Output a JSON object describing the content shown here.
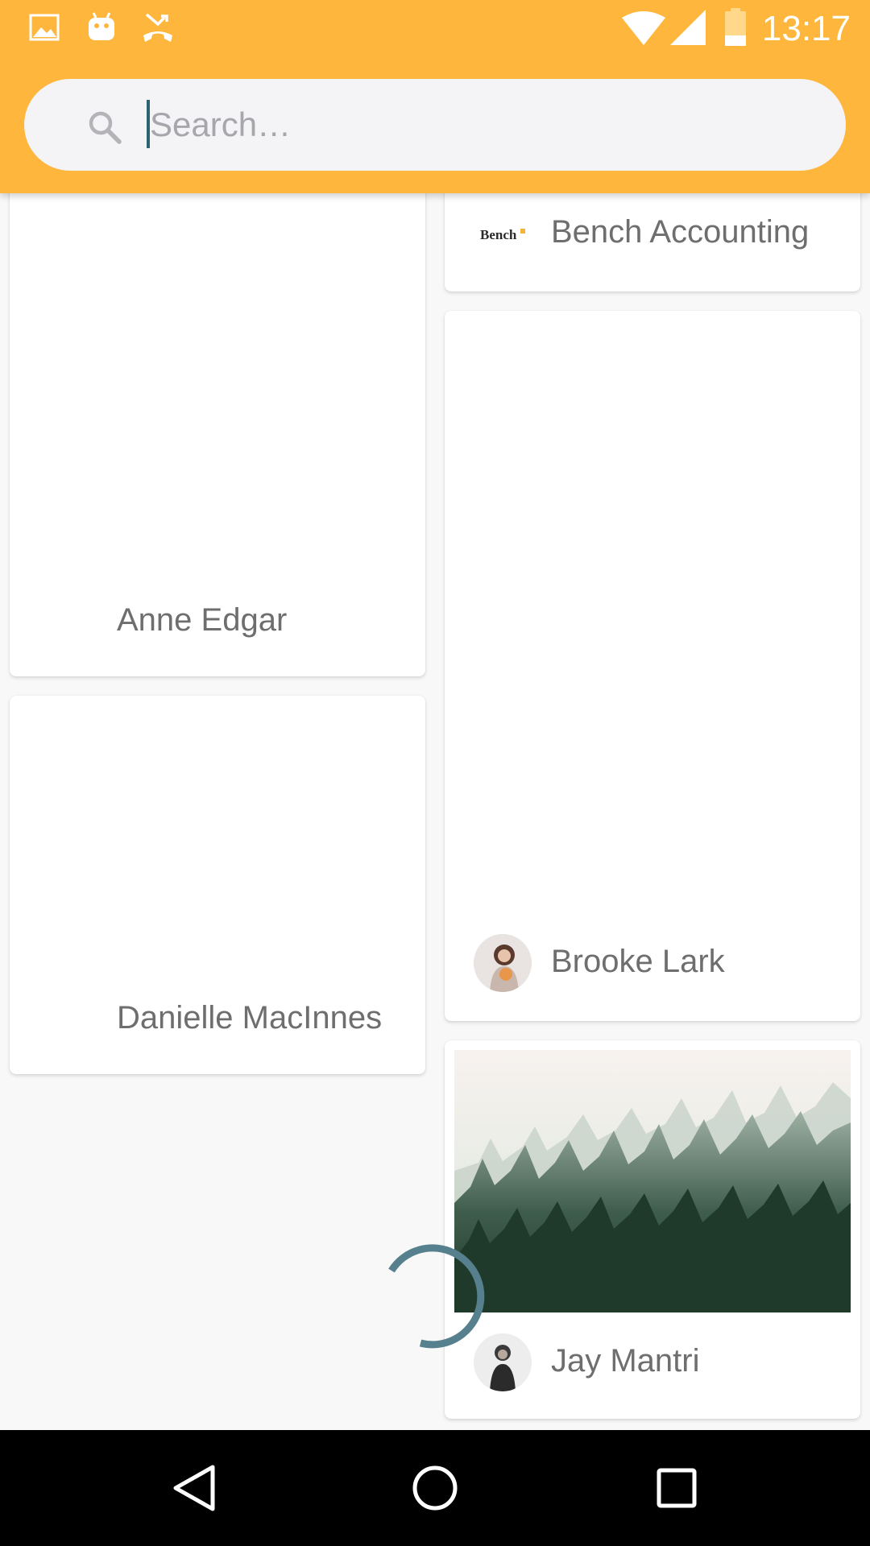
{
  "status_bar": {
    "time": "13:17",
    "left_icons": [
      "image-icon",
      "android-icon",
      "missed-call-icon"
    ],
    "right_icons": [
      "wifi-icon",
      "cell-signal-icon",
      "battery-icon"
    ]
  },
  "search": {
    "placeholder": "Search…",
    "value": ""
  },
  "feed": {
    "cards": [
      {
        "name": "Anne Edgar",
        "column": "left",
        "avatar": "none"
      },
      {
        "name": "Danielle MacInnes",
        "column": "left",
        "avatar": "none"
      },
      {
        "name": "Bench Accounting",
        "column": "right",
        "avatar": "bench-logo",
        "logo_text": "Bench"
      },
      {
        "name": "Brooke Lark",
        "column": "right",
        "avatar": "photo"
      },
      {
        "name": "Jay Mantri",
        "column": "right",
        "avatar": "photo",
        "image": "misty-forest"
      }
    ],
    "loading": true
  },
  "nav_bar": {
    "buttons": [
      "back-icon",
      "home-icon",
      "recents-icon"
    ]
  },
  "colors": {
    "header": "#ffb63c",
    "search_bg": "#f4f4f6",
    "spinner": "#56808e",
    "card_text": "#6e6e6e",
    "nav_bar": "#000000"
  }
}
